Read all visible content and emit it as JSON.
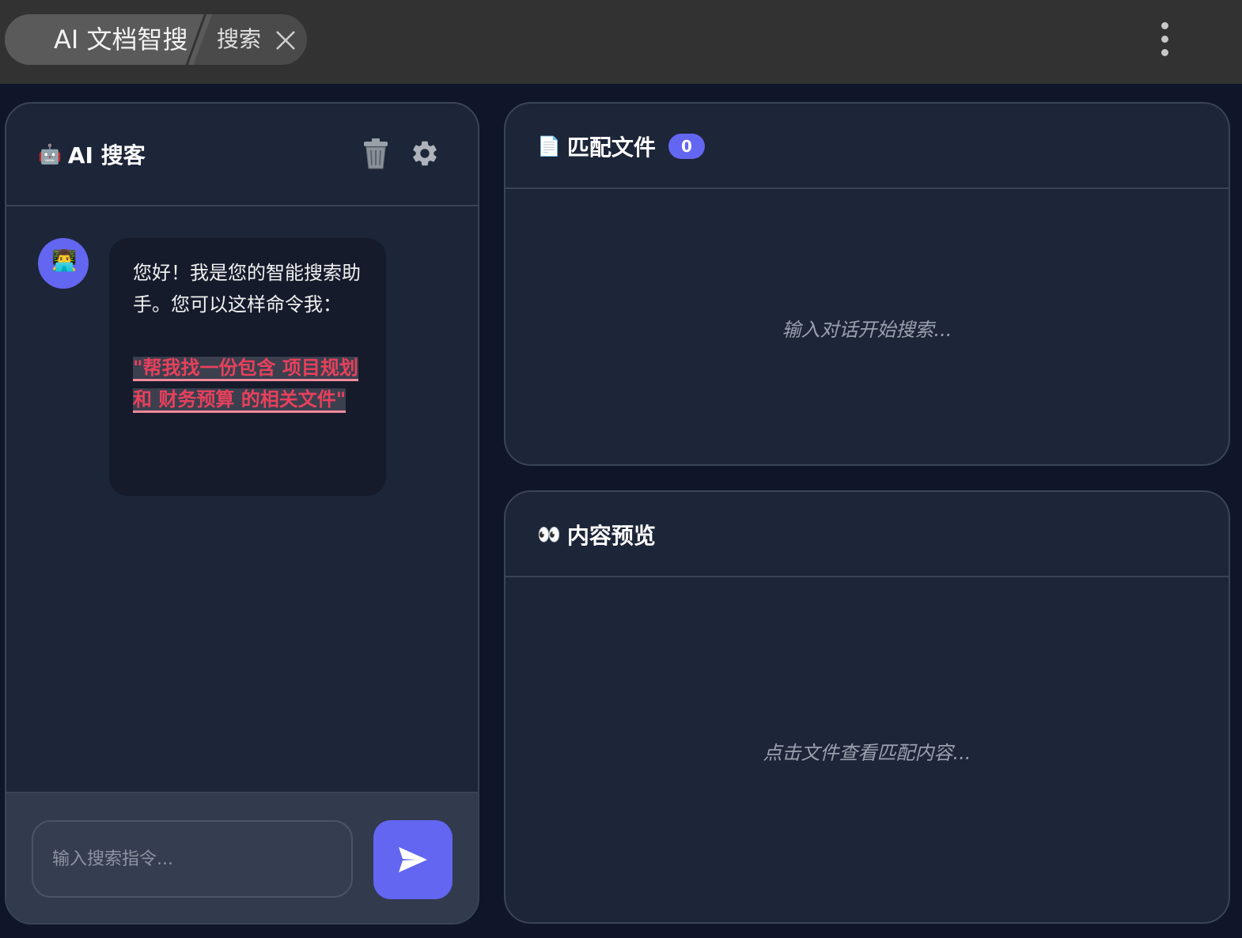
{
  "topbar": {
    "app_title": "AI 文档智搜",
    "tab_label": "搜索"
  },
  "chat_panel": {
    "title": "AI 搜客",
    "title_icon": "🤖",
    "avatar_icon": "👨‍💻",
    "greeting": "您好！我是您的智能搜索助手。您可以这样命令我：",
    "example_command": "\"帮我找一份包含 项目规划 和 财务预算 的相关文件\"",
    "input_placeholder": "输入搜索指令..."
  },
  "files_panel": {
    "title": "匹配文件",
    "title_icon": "📄",
    "count": "0",
    "empty_hint": "输入对话开始搜索..."
  },
  "preview_panel": {
    "title": "内容预览",
    "title_icon": "👀",
    "empty_hint": "点击文件查看匹配内容..."
  },
  "colors": {
    "accent": "#6366f1",
    "highlight": "#e8405c",
    "background": "#0f1629",
    "panel": "#1d2538"
  }
}
